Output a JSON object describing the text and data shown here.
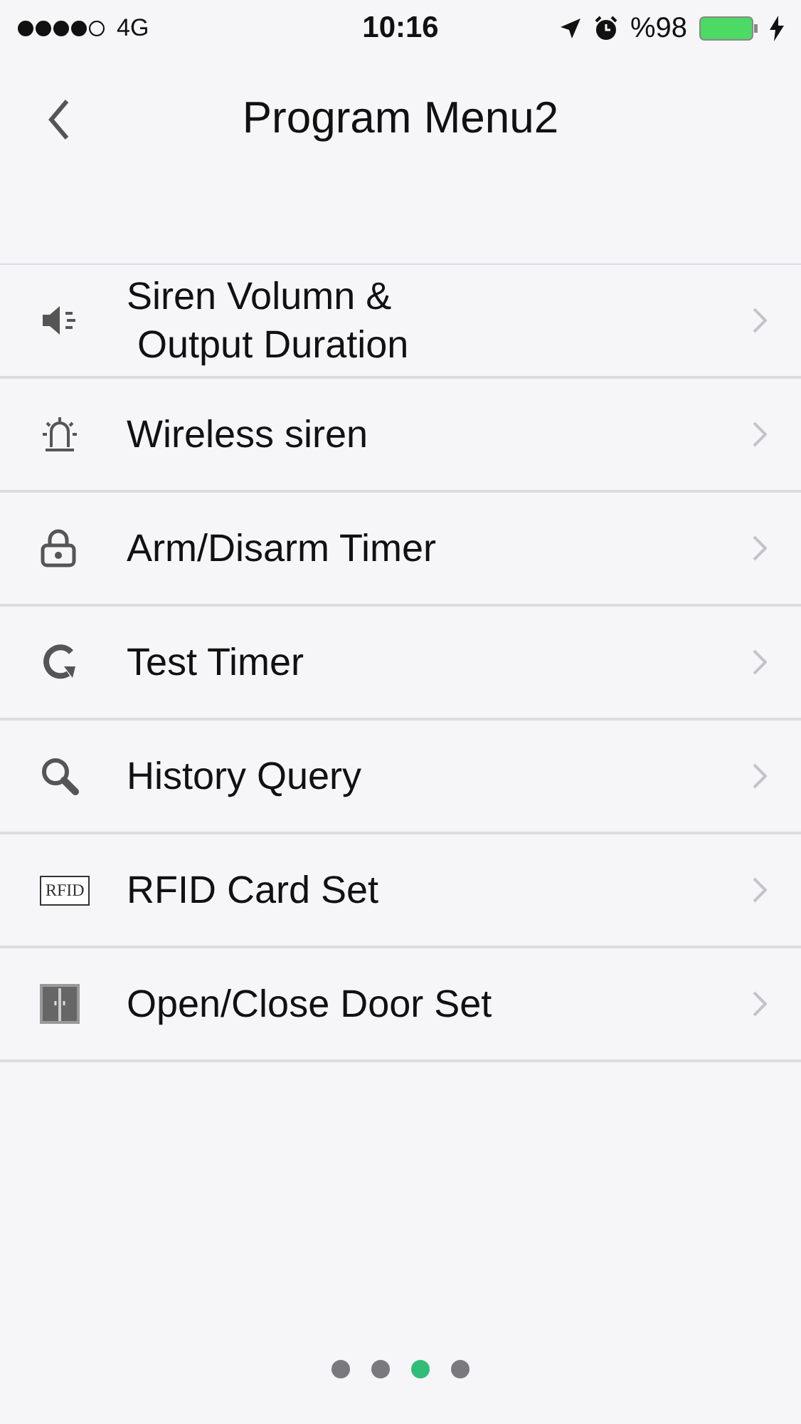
{
  "status_bar": {
    "network": "4G",
    "time": "10:16",
    "battery": "%98"
  },
  "nav": {
    "title": "Program Menu2"
  },
  "menu": [
    {
      "kind": "speaker",
      "label": "Siren Volumn &\n Output Duration"
    },
    {
      "kind": "siren",
      "label": "Wireless siren"
    },
    {
      "kind": "lock",
      "label": "Arm/Disarm Timer"
    },
    {
      "kind": "refresh",
      "label": "Test Timer"
    },
    {
      "kind": "search",
      "label": "History Query"
    },
    {
      "kind": "rfid",
      "icon_text": "RFID",
      "label": "RFID Card Set"
    },
    {
      "kind": "door",
      "label": "Open/Close Door Set"
    }
  ],
  "pages": [
    {
      "selected": false
    },
    {
      "selected": false
    },
    {
      "selected": true
    },
    {
      "selected": false
    }
  ]
}
